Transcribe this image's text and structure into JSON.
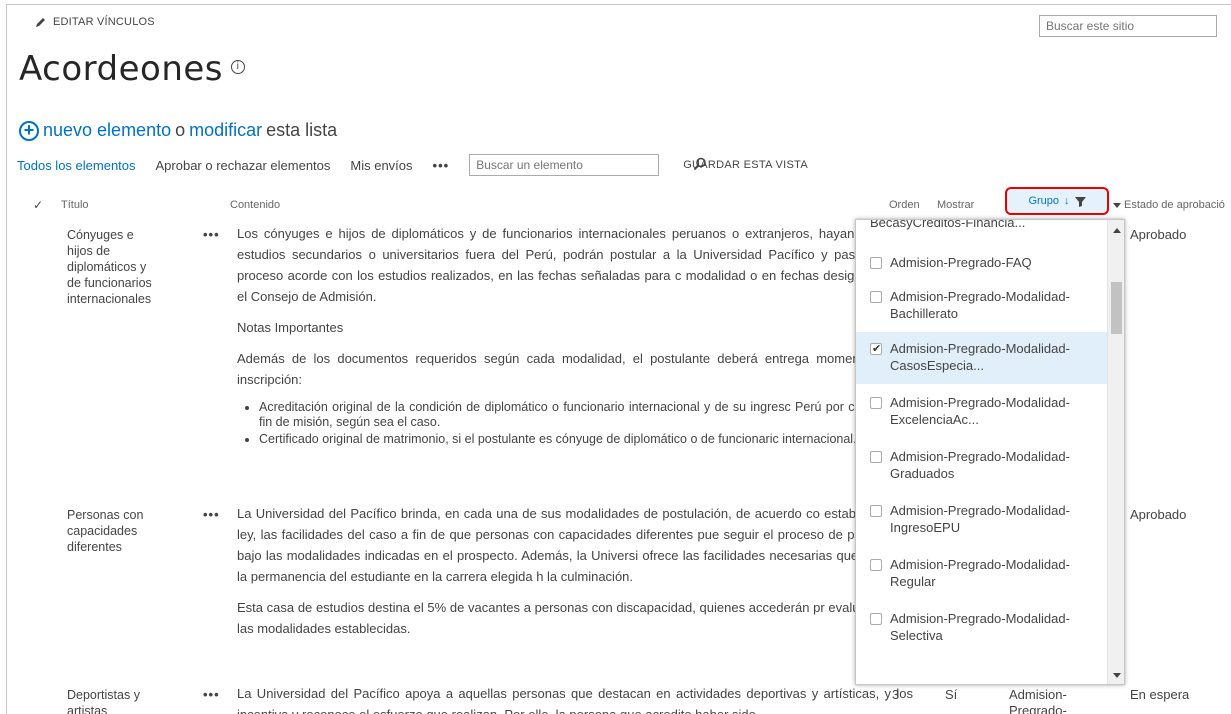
{
  "header": {
    "edit_links": "EDITAR VÍNCULOS",
    "site_search_placeholder": "Buscar este sitio",
    "page_title": "Acordeones",
    "info_glyph": "i"
  },
  "commands": {
    "new_item": "nuevo elemento",
    "or": "o",
    "modify": "modificar",
    "this_list": "esta lista"
  },
  "views": {
    "all_items": "Todos los elementos",
    "approve": "Aprobar o rechazar elementos",
    "my_submissions": "Mis envíos",
    "more": "•••",
    "search_placeholder": "Buscar un elemento",
    "save_view": "GUARDAR ESTA VISTA"
  },
  "columns": {
    "check": "✓",
    "title": "Título",
    "content": "Contenido",
    "order": "Orden",
    "show": "Mostrar",
    "group": "Grupo",
    "sort_arrow": "↓",
    "approval": "Estado de aprobació"
  },
  "rows": [
    {
      "title": [
        "Cónyuges e",
        "hijos de",
        "diplomáticos y",
        "de funcionarios",
        "internacionales"
      ],
      "dots": "•••",
      "p1": "Los cónyuges e hijos de diplomáticos y de funcionarios internacionales peruanos o extranjeros, hayan realizado estudios secundarios o universitarios fuera del Perú, podrán postular a la Universidad Pacífico y pasar por un proceso acorde con los estudios realizados, en las fechas señaladas para c modalidad o en fechas designadas por el Consejo de Admisión.",
      "p2": "Notas Importantes",
      "p3": "Además de los documentos requeridos según cada modalidad, el postulante deberá entrega momento de su inscripción:",
      "bullets": [
        "Acreditación original de la condición de diplomático o funcionario internacional y de su ingresc Perú por comienzo o fin de misión, según sea el caso.",
        "Certificado original de matrimonio, si el postulante es cónyuge de diplomático o de funcionaric internacional."
      ],
      "status": "Aprobado"
    },
    {
      "title": [
        "Personas con",
        "capacidades",
        "diferentes"
      ],
      "dots": "•••",
      "p1": "La Universidad del Pacífico brinda, en cada una de sus modalidades de postulación, de acuerdo co establecido por ley, las facilidades del caso a fin de que personas con capacidades diferentes pue seguir el proceso de postulación bajo las modalidades indicadas en el prospecto. Además, la Universi ofrece las facilidades necesarias que permitan la permanencia del estudiante en la carrera elegida h la culminación.",
      "p2": "Esta casa de estudios destina el 5% de vacantes a personas con discapacidad, quienes accederán pr evaluación por las modalidades establecidas.",
      "status": "Aprobado"
    },
    {
      "title": [
        "Deportistas y",
        "artistas"
      ],
      "dots": "•••",
      "p1": "La Universidad del Pacífico apoya a aquellas personas que destacan en actividades deportivas y artísticas, y los incentiva y reconoce el esfuerzo que realizan. Por ello, la persona que acredite haber sido",
      "order": "3",
      "show": "Sí",
      "group": [
        "Admision-",
        "Pregrado-"
      ],
      "status": "En espera"
    }
  ],
  "filter_dropdown": {
    "items": [
      {
        "lines": [
          "BecasyCreditos-Financia..."
        ],
        "checked": false
      },
      {
        "lines": [
          "Admision-Pregrado-FAQ"
        ],
        "checked": false
      },
      {
        "lines": [
          "Admision-Pregrado-Modalidad-",
          "Bachillerato"
        ],
        "checked": false
      },
      {
        "lines": [
          "Admision-Pregrado-Modalidad-",
          "CasosEspecia..."
        ],
        "checked": true
      },
      {
        "lines": [
          "Admision-Pregrado-Modalidad-",
          "ExcelenciaAc..."
        ],
        "checked": false
      },
      {
        "lines": [
          "Admision-Pregrado-Modalidad-",
          "Graduados"
        ],
        "checked": false
      },
      {
        "lines": [
          "Admision-Pregrado-Modalidad-",
          "IngresoEPU"
        ],
        "checked": false
      },
      {
        "lines": [
          "Admision-Pregrado-Modalidad-",
          "Regular"
        ],
        "checked": false
      },
      {
        "lines": [
          "Admision-Pregrado-Modalidad-",
          "Selectiva"
        ],
        "checked": false
      }
    ]
  },
  "colors": {
    "link": "#0072c6",
    "highlight": "#e00000",
    "selected_bg": "#e1effa"
  }
}
